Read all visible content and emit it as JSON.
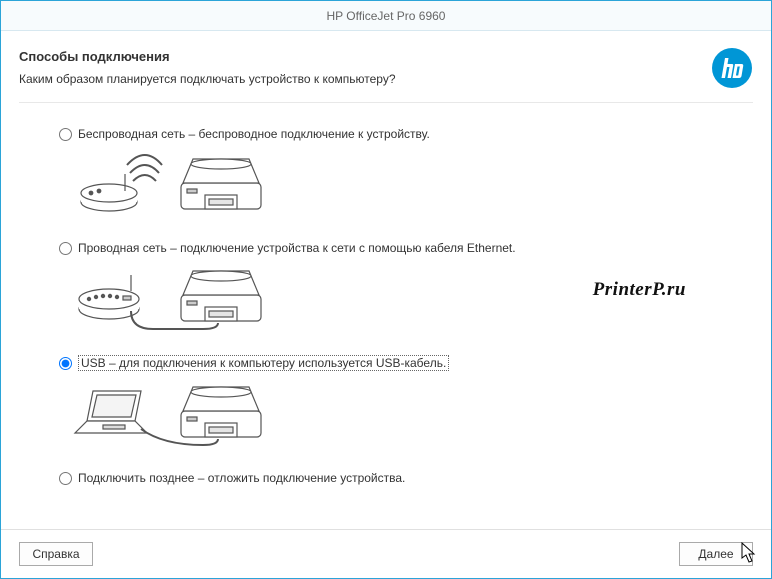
{
  "window": {
    "title": "HP OfficeJet Pro 6960"
  },
  "header": {
    "title": "Способы подключения",
    "subtitle": "Каким образом планируется подключать устройство к компьютеру?"
  },
  "options": {
    "wireless": "Беспроводная сеть – беспроводное подключение к устройству.",
    "ethernet": "Проводная сеть – подключение устройства к сети с помощью кабеля Ethernet.",
    "usb": "USB – для подключения к компьютеру используется USB-кабель.",
    "later": "Подключить позднее – отложить подключение устройства."
  },
  "footer": {
    "help": "Справка",
    "next": "Далее"
  },
  "watermark": "PrinterP.ru"
}
